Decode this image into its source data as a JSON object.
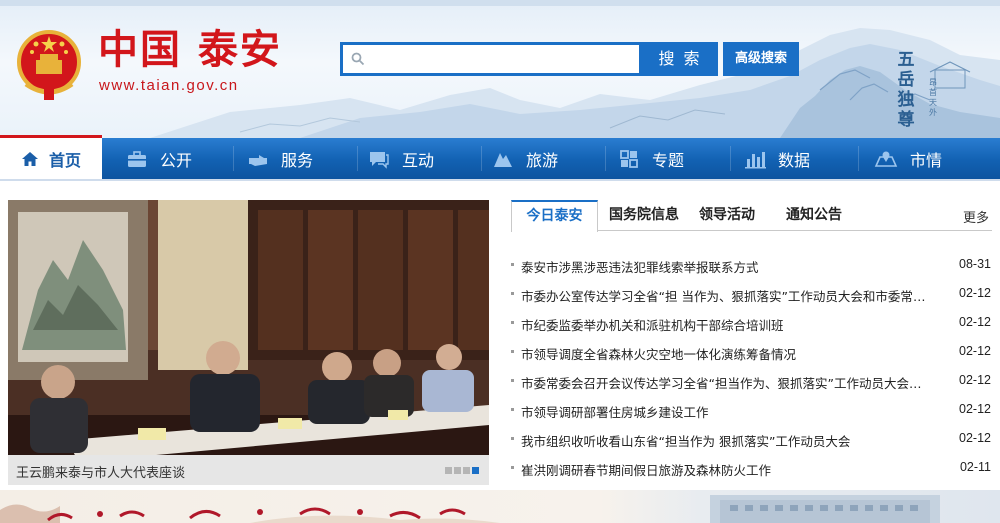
{
  "header": {
    "site_title": "中国 泰安",
    "site_url": "www.taian.gov.cn",
    "search": {
      "placeholder": "",
      "button_label": "搜 索",
      "advanced_label": "高级搜索"
    },
    "calligraphy": "五岳独尊",
    "calligraphy_small": "昂首天外"
  },
  "nav": {
    "items": [
      {
        "label": "首页",
        "icon": "home-icon",
        "active": true
      },
      {
        "label": "公开",
        "icon": "briefcase-icon"
      },
      {
        "label": "服务",
        "icon": "hand-pointer-icon"
      },
      {
        "label": "互动",
        "icon": "chat-icon"
      },
      {
        "label": "旅游",
        "icon": "mountain-icon"
      },
      {
        "label": "专题",
        "icon": "grid-icon"
      },
      {
        "label": "数据",
        "icon": "bar-chart-icon"
      },
      {
        "label": "市情",
        "icon": "map-icon"
      }
    ]
  },
  "slideshow": {
    "caption": "王云鹏来泰与市人大代表座谈",
    "total_slides": 4,
    "current_slide": 4
  },
  "news": {
    "tabs": [
      "今日泰安",
      "国务院信息",
      "领导活动",
      "通知公告"
    ],
    "active_tab": "今日泰安",
    "more_label": "更多",
    "items": [
      {
        "title": "泰安市涉黑涉恶违法犯罪线索举报联系方式",
        "date": "08-31"
      },
      {
        "title": "市委办公室传达学习全省“担 当作为、狠抓落实”工作动员大会和市委常委会议精神",
        "date": "02-12"
      },
      {
        "title": "市纪委监委举办机关和派驻机构干部综合培训班",
        "date": "02-12"
      },
      {
        "title": "市领导调度全省森林火灾空地一体化演练筹备情况",
        "date": "02-12"
      },
      {
        "title": "市委常委会召开会议传达学习全省“担当作为、狠抓落实”工作动员大会精神",
        "date": "02-12"
      },
      {
        "title": "市领导调研部署住房城乡建设工作",
        "date": "02-12"
      },
      {
        "title": "我市组织收听收看山东省“担当作为 狠抓落实”工作动员大会",
        "date": "02-12"
      },
      {
        "title": "崔洪刚调研春节期间假日旅游及森林防火工作",
        "date": "02-11"
      }
    ]
  },
  "colors": {
    "brand_red": "#d2161b",
    "brand_blue": "#1a6fc6",
    "nav_blue": "#1261b2"
  }
}
